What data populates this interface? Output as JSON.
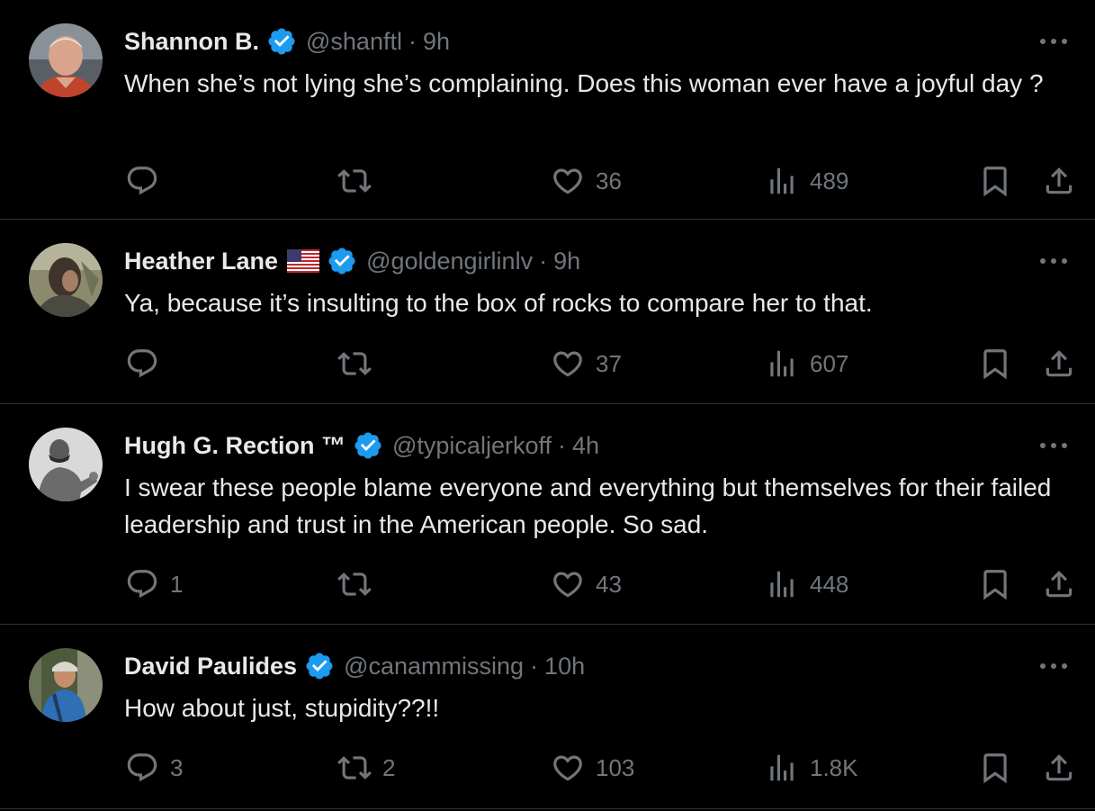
{
  "colors": {
    "background": "#000000",
    "text": "#e7e9ea",
    "muted": "#71767b",
    "divider": "#2f3336",
    "verified": "#1d9bf0"
  },
  "icons": {
    "more": "more-horizontal-icon",
    "reply": "reply-icon",
    "retweet": "retweet-icon",
    "like": "heart-icon",
    "views": "views-chart-icon",
    "bookmark": "bookmark-icon",
    "share": "share-icon",
    "verified": "verified-badge-icon",
    "flag": "us-flag-icon"
  },
  "tweets": [
    {
      "display_name": "Shannon B.",
      "handle": "@shanftl",
      "separator": "·",
      "time": "9h",
      "text": "When she’s not lying she’s complaining. Does this woman ever have a joyful day ?",
      "replies": "",
      "retweets": "",
      "likes": "36",
      "views": "489"
    },
    {
      "display_name": "Heather Lane",
      "handle": "@goldengirlinlv",
      "separator": "·",
      "time": "9h",
      "text": "Ya, because it’s insulting to the box of rocks to compare her to that.",
      "replies": "",
      "retweets": "",
      "likes": "37",
      "views": "607"
    },
    {
      "display_name": "Hugh G. Rection ™",
      "handle": "@typicaljerkoff",
      "separator": "·",
      "time": "4h",
      "text": "I swear these people blame everyone and everything but themselves for their failed leadership and trust in the American people. So sad.",
      "replies": "1",
      "retweets": "",
      "likes": "43",
      "views": "448"
    },
    {
      "display_name": "David Paulides",
      "handle": "@canammissing",
      "separator": "·",
      "time": "10h",
      "text": "How about just, stupidity??!!",
      "replies": "3",
      "retweets": "2",
      "likes": "103",
      "views": "1.8K"
    }
  ]
}
